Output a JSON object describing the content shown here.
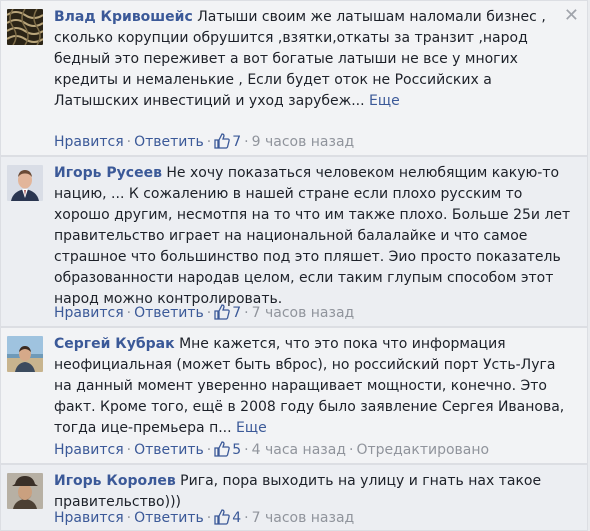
{
  "comments": [
    {
      "author": "Влад Кривошейс",
      "text": "Латыши своим же латышам наломали бизнес , сколько корупции обрушится ,взятки,откаты за транзит ,народ бедный это переживет а вот богатые латыши не все у многих кредиты и немаленькие , Если будет оток не Российских а Латышских инвестиций и уход зарубеж...",
      "more": "Еще",
      "like": "Нравится",
      "reply": "Ответить",
      "likes": "7",
      "time": "9 часов назад",
      "avatar_icon": "patterned-avatar"
    },
    {
      "author": "Игорь Русеев",
      "text": "Не хочу показаться человеком нелюбящим какую-то нацию, ... К сожалению в нашей стране если плохо русским то хорошо другим, несмотпя на то что им также плохо. Больше 25и лет правительство играет на национальной балалайке и что самое страшное что большинство под это пляшет. Эио просто показатель образованности народав целом, если таким глупым способом этот народ можно контролировать.",
      "like": "Нравится",
      "reply": "Ответить",
      "likes": "7",
      "time": "7 часов назад",
      "avatar_icon": "man-suit-avatar"
    },
    {
      "author": "Сергей Кубрак",
      "text": "Мне кажется, что это пока что информация неофициальная (может быть вброс), но российский порт Усть-Луга на данный момент уверенно наращивает мощности, конечно. Это факт. Кроме того, ещё в 2008 году было заявление Сергея Иванова, тогда ице-премьера п...",
      "more": "Еще",
      "like": "Нравится",
      "reply": "Ответить",
      "likes": "5",
      "time": "4 часа назад",
      "edited": "Отредактировано",
      "avatar_icon": "man-seaside-avatar"
    },
    {
      "author": "Игорь Королев",
      "text": "Рига, пора выходить на улицу и гнать нах такое правительство)))",
      "like": "Нравится",
      "reply": "Ответить",
      "likes": "4",
      "time": "7 часов назад",
      "avatar_icon": "man-hat-avatar"
    }
  ],
  "close_symbol": "✕",
  "colors": {
    "link": "#3b5998",
    "meta": "#90949c",
    "text": "#1d2129"
  }
}
